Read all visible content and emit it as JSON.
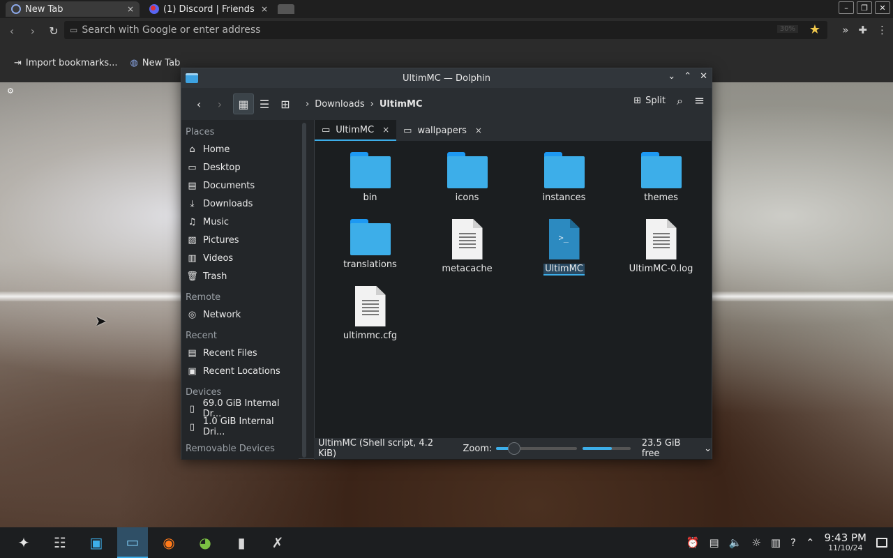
{
  "browser": {
    "tabs": [
      {
        "label": "New Tab",
        "close": "×"
      },
      {
        "label": "(1) Discord | Friends",
        "close": "×"
      }
    ],
    "window_controls": [
      "–",
      "❐",
      "✕"
    ],
    "url_placeholder": "Search with Google or enter address",
    "url_zoom": "30%",
    "bookmarks": [
      "Import bookmarks...",
      "New Tab"
    ]
  },
  "dolphin": {
    "title": "UltimMC — Dolphin",
    "titlebar_buttons": [
      "⌄",
      "⌃",
      "✕"
    ],
    "breadcrumb": [
      "Downloads",
      "UltimMC"
    ],
    "split_label": "Split",
    "places": {
      "sections": {
        "places": "Places",
        "remote": "Remote",
        "recent": "Recent",
        "devices": "Devices",
        "removable": "Removable Devices"
      },
      "places_items": [
        "Home",
        "Desktop",
        "Documents",
        "Downloads",
        "Music",
        "Pictures",
        "Videos",
        "Trash"
      ],
      "remote_items": [
        "Network"
      ],
      "recent_items": [
        "Recent Files",
        "Recent Locations"
      ],
      "devices": [
        {
          "label": "69.0 GiB Internal Dr...",
          "usage": 0.62
        },
        {
          "label": "1.0 GiB Internal Dri...",
          "usage": 0.3
        }
      ]
    },
    "view_tabs": [
      {
        "label": "UltimMC",
        "close": "×"
      },
      {
        "label": "wallpapers",
        "close": "×"
      }
    ],
    "files": [
      {
        "name": "bin",
        "kind": "folder"
      },
      {
        "name": "icons",
        "kind": "folder"
      },
      {
        "name": "instances",
        "kind": "folder"
      },
      {
        "name": "themes",
        "kind": "folder"
      },
      {
        "name": "translations",
        "kind": "folder"
      },
      {
        "name": "metacache",
        "kind": "document"
      },
      {
        "name": "UltimMC",
        "kind": "script",
        "selected": true
      },
      {
        "name": "UltimMC-0.log",
        "kind": "document"
      },
      {
        "name": "ultimmc.cfg",
        "kind": "document"
      }
    ],
    "status": {
      "selection": "UltimMC (Shell script, 4.2 KiB)",
      "zoom_label": "Zoom:",
      "zoom_level": 0.22,
      "disk_used_fraction": 0.62,
      "free_space": "23.5 GiB free"
    }
  },
  "taskbar": {
    "clock_time": "9:43 PM",
    "clock_date": "11/10/24"
  },
  "colors": {
    "accent": "#3daee9",
    "folder": "#3daee9",
    "window_bg": "#232629",
    "view_bg": "#1b1e20"
  }
}
